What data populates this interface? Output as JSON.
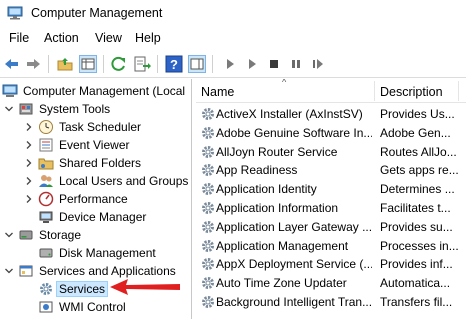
{
  "window": {
    "title": "Computer Management"
  },
  "menu": [
    "File",
    "Action",
    "View",
    "Help"
  ],
  "toolbar": {
    "buttons": [
      "back-icon",
      "forward-icon",
      "up-folder-icon",
      "show-hide-tree-icon",
      "refresh-icon",
      "export-list-icon",
      "help-icon",
      "properties-pane-icon",
      "start-service-icon",
      "start-service-alt-icon",
      "stop-service-icon",
      "pause-service-icon",
      "restart-service-icon"
    ]
  },
  "tree": {
    "root": "Computer Management (Local",
    "system_tools": "System Tools",
    "task_scheduler": "Task Scheduler",
    "event_viewer": "Event Viewer",
    "shared_folders": "Shared Folders",
    "local_users": "Local Users and Groups",
    "performance": "Performance",
    "device_manager": "Device Manager",
    "storage": "Storage",
    "disk_management": "Disk Management",
    "services_apps": "Services and Applications",
    "services": "Services",
    "wmi_control": "WMI Control"
  },
  "list": {
    "columns": {
      "name": "Name",
      "description": "Description"
    },
    "rows": [
      {
        "name": "ActiveX Installer (AxInstSV)",
        "description": "Provides Us..."
      },
      {
        "name": "Adobe Genuine Software In...",
        "description": "Adobe Gen..."
      },
      {
        "name": "AllJoyn Router Service",
        "description": "Routes AllJo..."
      },
      {
        "name": "App Readiness",
        "description": "Gets apps re..."
      },
      {
        "name": "Application Identity",
        "description": "Determines ..."
      },
      {
        "name": "Application Information",
        "description": "Facilitates t..."
      },
      {
        "name": "Application Layer Gateway ...",
        "description": "Provides su..."
      },
      {
        "name": "Application Management",
        "description": "Processes in..."
      },
      {
        "name": "AppX Deployment Service (...",
        "description": "Provides inf..."
      },
      {
        "name": "Auto Time Zone Updater",
        "description": "Automatica..."
      },
      {
        "name": "Background Intelligent Tran...",
        "description": "Transfers fil..."
      }
    ]
  },
  "colors": {
    "selection": "#cce8ff",
    "annotation_arrow": "#e02020"
  }
}
